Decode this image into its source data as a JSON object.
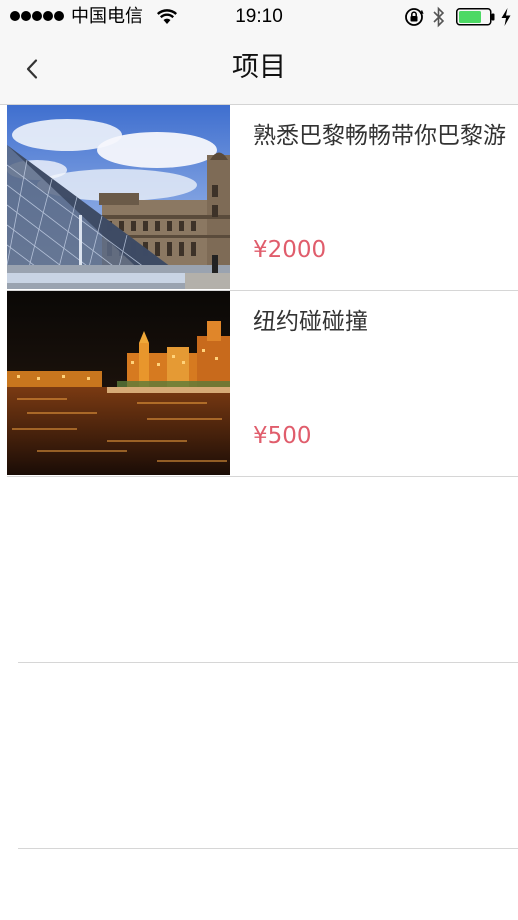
{
  "status_bar": {
    "carrier": "中国电信",
    "time": "19:10",
    "signal_bars": 5,
    "battery_level": 0.72
  },
  "nav": {
    "back_icon": "chevron-left-icon",
    "title": "项目"
  },
  "projects": [
    {
      "title": "熟悉巴黎畅畅带你巴黎游",
      "price": "¥2000",
      "image": "louvre-pyramid-photo"
    },
    {
      "title": "纽约碰碰撞",
      "price": "¥500",
      "image": "night-city-river-photo"
    }
  ],
  "colors": {
    "price": "#e05d6c",
    "nav_background": "#f7f7f7",
    "divider": "#d6d6d6"
  }
}
